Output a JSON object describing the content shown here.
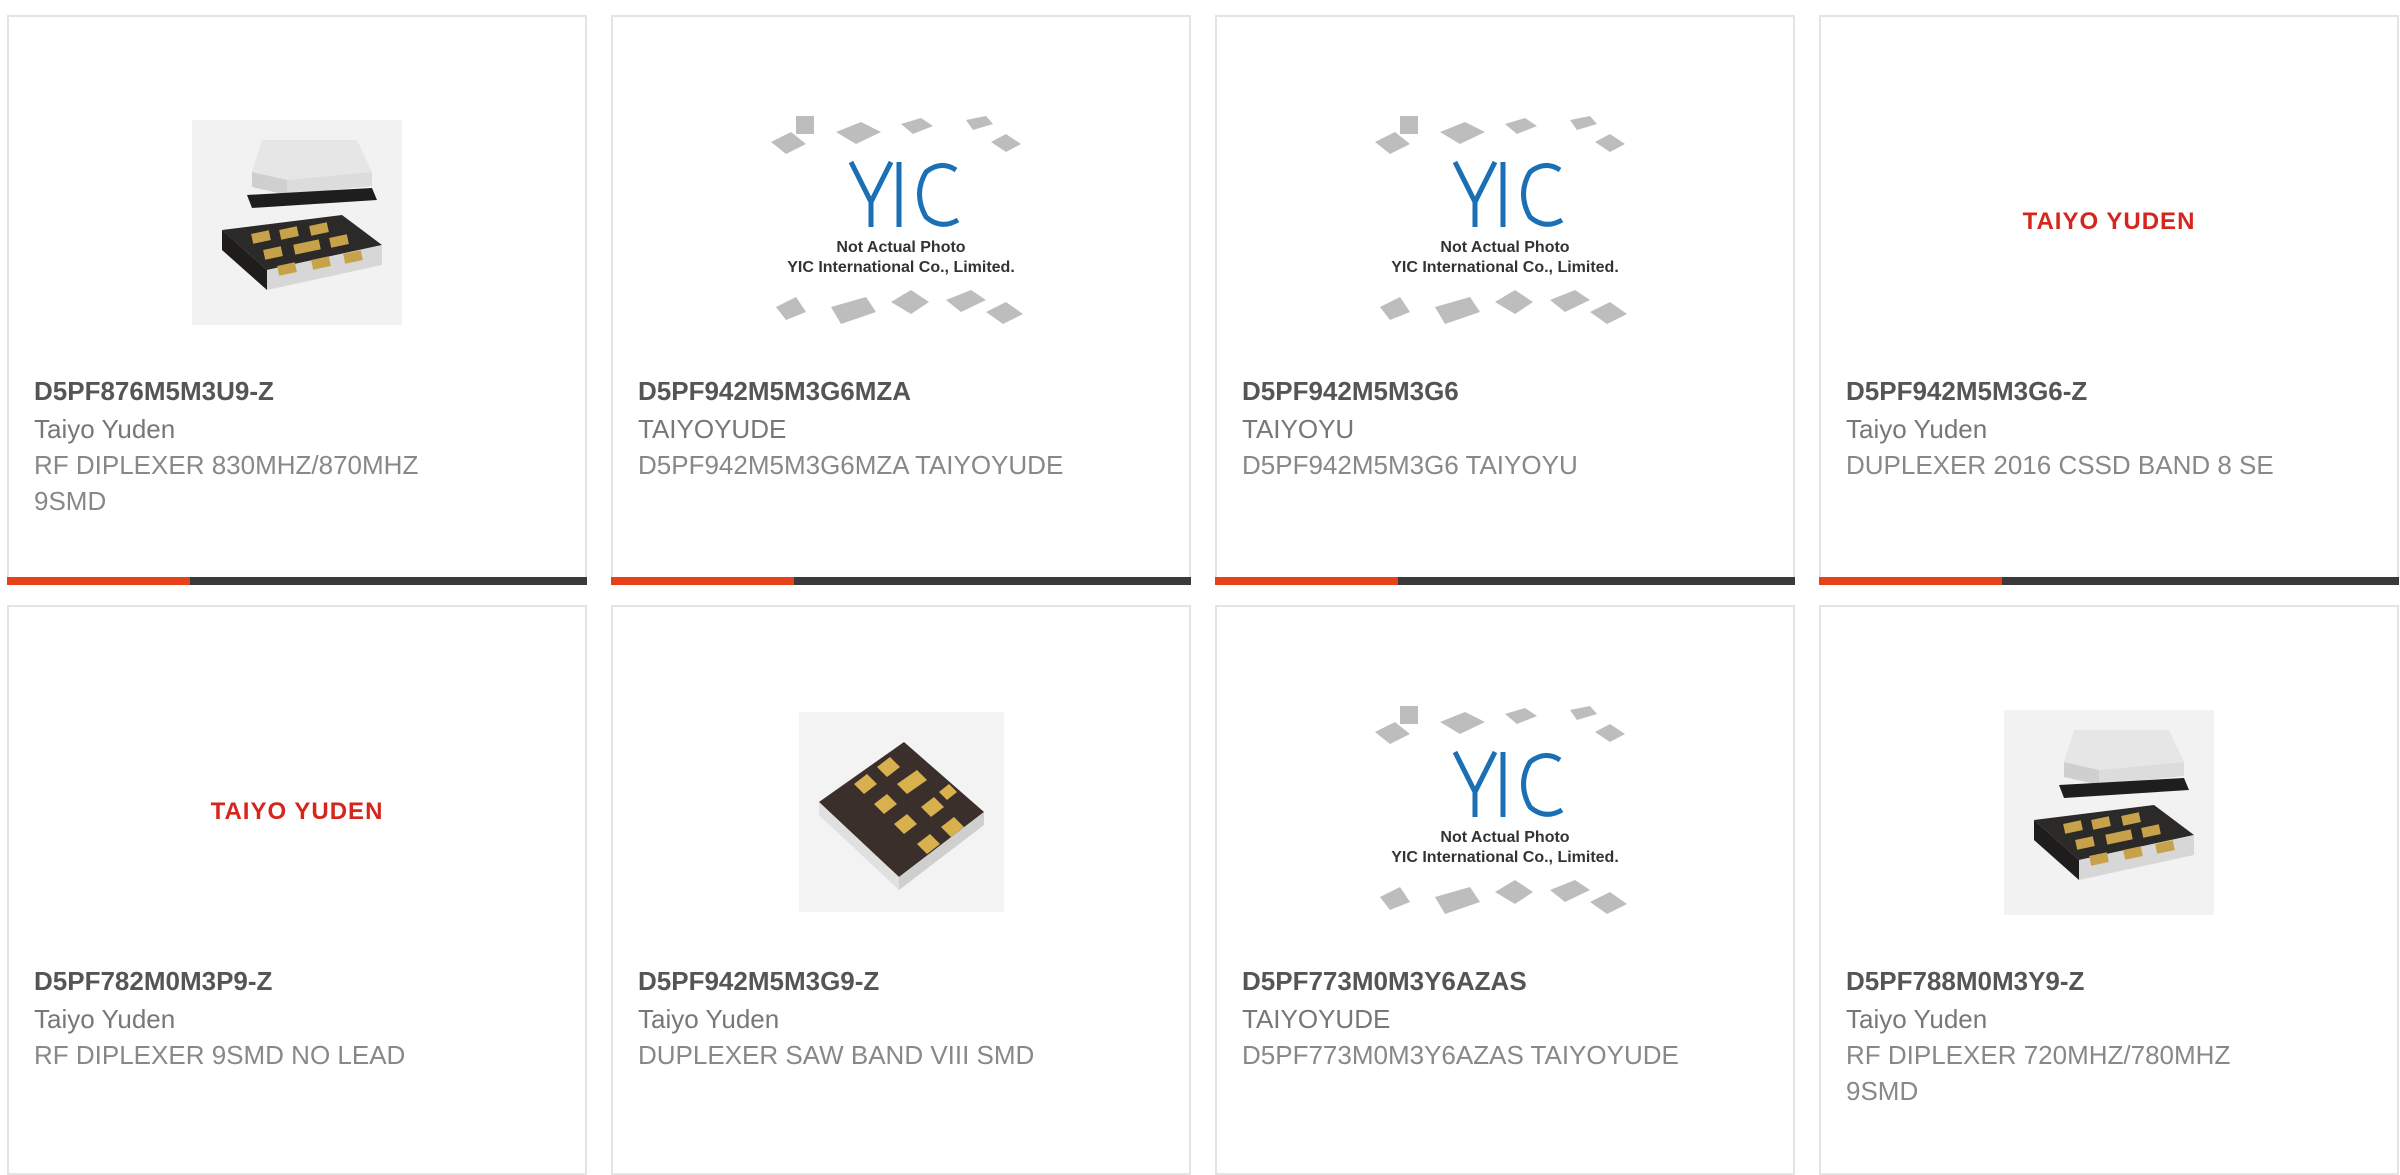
{
  "products": [
    {
      "part": "D5PF876M5M3U9-Z",
      "brand": "Taiyo Yuden",
      "desc": "RF DIPLEXER 830MHZ/870MHZ 9SMD",
      "image": "chip-module-icon"
    },
    {
      "part": "D5PF942M5M3G6MZA",
      "brand": "TAIYOYUDE",
      "desc": "D5PF942M5M3G6MZA TAIYOYUDE",
      "image": "yic-placeholder",
      "img_text1": "Not Actual Photo",
      "img_text2": "YIC International Co., Limited."
    },
    {
      "part": "D5PF942M5M3G6",
      "brand": "TAIYOYU",
      "desc": "D5PF942M5M3G6 TAIYOYU",
      "image": "yic-placeholder",
      "img_text1": "Not Actual Photo",
      "img_text2": "YIC International Co., Limited."
    },
    {
      "part": "D5PF942M5M3G6-Z",
      "brand": "Taiyo Yuden",
      "desc": "DUPLEXER 2016 CSSD BAND 8 SE",
      "image": "taiyo-yuden-logo",
      "logo": "TAIYO YUDEN"
    },
    {
      "part": "D5PF782M0M3P9-Z",
      "brand": "Taiyo Yuden",
      "desc": "RF DIPLEXER 9SMD NO LEAD",
      "image": "taiyo-yuden-logo",
      "logo": "TAIYO YUDEN"
    },
    {
      "part": "D5PF942M5M3G9-Z",
      "brand": "Taiyo Yuden",
      "desc": "DUPLEXER SAW BAND VIII SMD",
      "image": "chip-pads-icon"
    },
    {
      "part": "D5PF773M0M3Y6AZAS",
      "brand": "TAIYOYUDE",
      "desc": "D5PF773M0M3Y6AZAS TAIYOYUDE",
      "image": "yic-placeholder",
      "img_text1": "Not Actual Photo",
      "img_text2": "YIC International Co., Limited."
    },
    {
      "part": "D5PF788M0M3Y9-Z",
      "brand": "Taiyo Yuden",
      "desc": "RF DIPLEXER 720MHZ/780MHZ 9SMD",
      "image": "chip-module-icon"
    }
  ],
  "colors": {
    "accent": "#e8401a",
    "bar": "#3a3a3a",
    "border": "#e4e4e4",
    "logo_red": "#d4261c",
    "yic_blue": "#1a6fb5"
  }
}
